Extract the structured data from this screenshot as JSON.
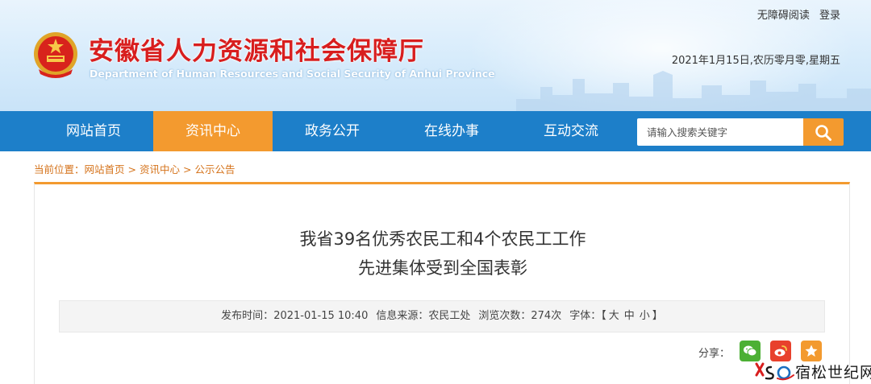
{
  "header": {
    "title_cn": "安徽省人力资源和社会保障厅",
    "title_en": "Department of Human Resources and Social Security of Anhui Province",
    "accessibility_link": "无障碍阅读",
    "login_link": "登录",
    "date_text": "2021年1月15日,农历零月零,星期五"
  },
  "nav": {
    "items": [
      "网站首页",
      "资讯中心",
      "政务公开",
      "在线办事",
      "互动交流"
    ],
    "active_index": 1,
    "search_placeholder": "请输入搜索关键字",
    "search_icon": "search-icon"
  },
  "breadcrumb": {
    "prefix": "当前位置：",
    "items": [
      "网站首页",
      "资讯中心",
      "公示公告"
    ],
    "separator": ">"
  },
  "article": {
    "title_line1": "我省39名优秀农民工和4个农民工工作",
    "title_line2": "先进集体受到全国表彰",
    "meta": {
      "publish_label": "发布时间：",
      "publish_time": "2021-01-15 10:40",
      "source_label": "信息来源：",
      "source": "农民工处",
      "views_label": "浏览次数：",
      "views": "274次",
      "font_label": "字体：",
      "bracket_open": "【",
      "font_large": "大",
      "font_medium": "中",
      "font_small": "小",
      "bracket_close": "】"
    },
    "share": {
      "label": "分享：",
      "icons": [
        "wechat-icon",
        "weibo-icon",
        "qzone-icon"
      ]
    }
  },
  "watermark": {
    "text": "宿松世纪网"
  },
  "colors": {
    "nav_blue": "#1d7fc9",
    "accent_orange": "#f39a2f",
    "title_red": "#d81e1e",
    "breadcrumb_orange": "#d5731b",
    "wechat_green": "#4cb034",
    "weibo_red": "#e8412c",
    "qzone_orange": "#f39a2f"
  }
}
